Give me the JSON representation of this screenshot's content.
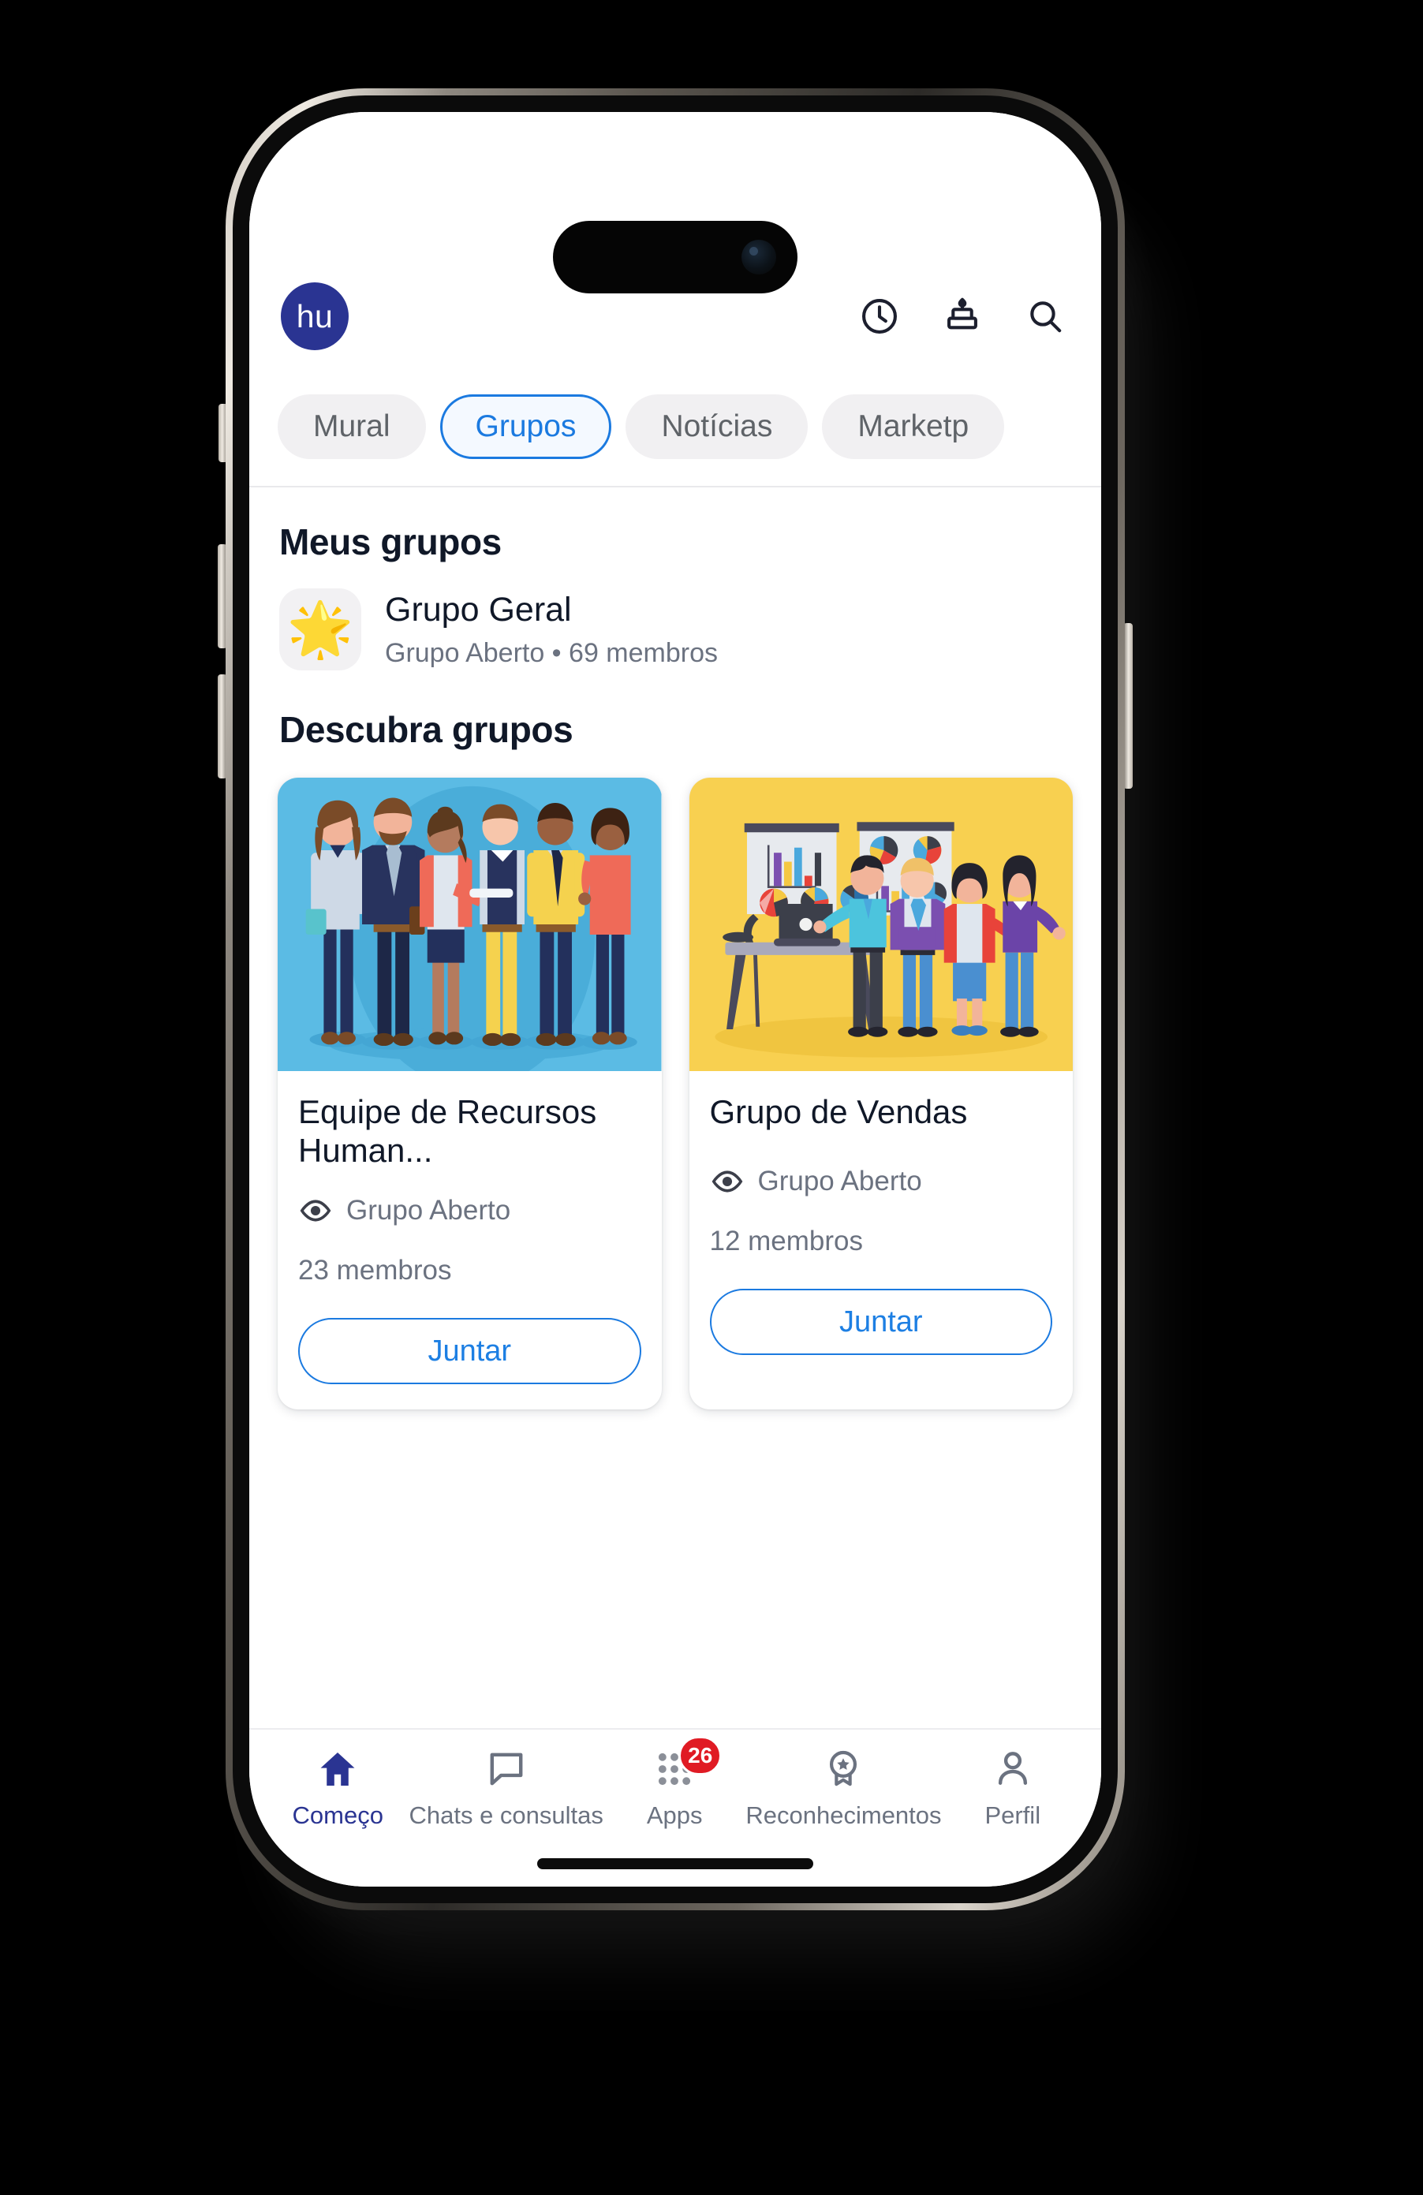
{
  "header": {
    "logo_text": "hu",
    "logo_color": "#2a3492",
    "actions": [
      {
        "name": "clock-icon",
        "label": "Histórico"
      },
      {
        "name": "cake-icon",
        "label": "Aniversários"
      },
      {
        "name": "search-icon",
        "label": "Buscar"
      }
    ]
  },
  "tabs": [
    {
      "label": "Mural",
      "active": false
    },
    {
      "label": "Grupos",
      "active": true
    },
    {
      "label": "Notícias",
      "active": false
    },
    {
      "label": "Marketp",
      "active": false
    }
  ],
  "my_groups": {
    "title": "Meus grupos",
    "items": [
      {
        "icon": "🌟",
        "name": "Grupo Geral",
        "subtitle": "Grupo Aberto • 69 membros",
        "privacy": "Grupo Aberto",
        "members": "69 membros"
      }
    ]
  },
  "discover": {
    "title": "Descubra grupos",
    "cards": [
      {
        "title": "Equipe de Recursos Human...",
        "privacy": "Grupo Aberto",
        "members": "23 membros",
        "join_label": "Juntar",
        "image_bg": "#5bbbe4"
      },
      {
        "title": "Grupo de Vendas",
        "privacy": "Grupo Aberto",
        "members": "12 membros",
        "join_label": "Juntar",
        "image_bg": "#f8d050"
      }
    ]
  },
  "bottom_nav": {
    "items": [
      {
        "label": "Começo",
        "icon": "home-icon",
        "active": true,
        "badge": ""
      },
      {
        "label": "Chats e consultas",
        "icon": "chat-icon",
        "active": false,
        "badge": ""
      },
      {
        "label": "Apps",
        "icon": "grid-icon",
        "active": false,
        "badge": "26"
      },
      {
        "label": "Reconhecimentos",
        "icon": "award-icon",
        "active": false,
        "badge": ""
      },
      {
        "label": "Perfil",
        "icon": "person-icon",
        "active": false,
        "badge": ""
      }
    ],
    "active_color": "#2a3492",
    "badge_color": "#e01b24"
  }
}
